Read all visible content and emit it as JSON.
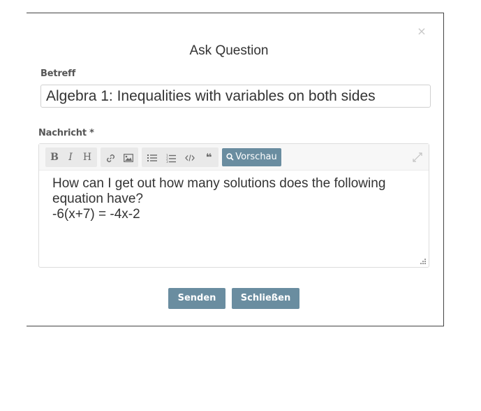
{
  "dialog": {
    "title": "Ask Question",
    "close_glyph": "×"
  },
  "subject": {
    "label": "Betreff",
    "value": "Algebra 1: Inequalities with variables on both sides"
  },
  "message": {
    "label": "Nachricht *",
    "text": "How can I get out how many solutions does the following equation have?\n-6(x+7) = -4x-2"
  },
  "toolbar": {
    "bold": "B",
    "italic": "I",
    "heading": "H",
    "link_icon": "link-icon",
    "image_icon": "image-icon",
    "ul_icon": "unordered-list-icon",
    "ol_icon": "ordered-list-icon",
    "code_icon": "code-icon",
    "quote_icon": "quote-icon",
    "quote_glyph": "❝",
    "preview_label": "Vorschau",
    "expand_icon": "expand-icon"
  },
  "buttons": {
    "send_label": "Senden",
    "close_label": "Schließen"
  },
  "colors": {
    "accent": "#6a8da0",
    "text": "#333333",
    "label": "#555555",
    "toolbar_bg": "#f7f7f7"
  }
}
